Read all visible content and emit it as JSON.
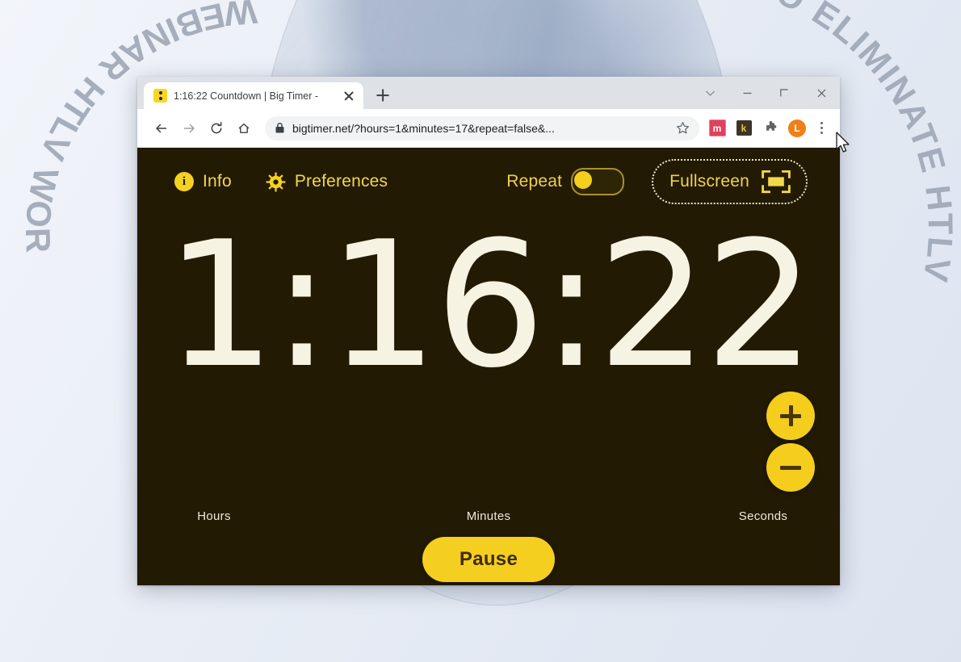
{
  "desktop": {
    "watermark_left": "WEBINAR HTLV WOR",
    "watermark_right": "TO ELIMINATE HTLV",
    "globe_name": "world-globe-graphic"
  },
  "browser": {
    "tab": {
      "title": "1:16:22 Countdown | Big Timer -",
      "favicon_name": "big-timer-favicon",
      "close_label": "×"
    },
    "new_tab_label": "+",
    "window_controls": {
      "tab_search_label": "⌄",
      "minimize_label": "–",
      "maximize_label": "□",
      "close_label": "×"
    },
    "toolbar": {
      "back_label": "←",
      "forward_label": "→",
      "reload_label": "↻",
      "home_label": "⌂",
      "lock_label": "🔒",
      "url": "bigtimer.net/?hours=1&minutes=17&repeat=false&...",
      "star_label": "☆",
      "extensions": [
        {
          "name": "ext-icon-m",
          "label": "m",
          "color": "#e0405e"
        },
        {
          "name": "ext-icon-k",
          "label": "k",
          "color": "#3b3427"
        }
      ],
      "puzzle_label": "extensions",
      "avatar_label": "L",
      "menu_label": "⋮"
    }
  },
  "app": {
    "toolbar": {
      "info_label": "Info",
      "info_icon_glyph": "i",
      "preferences_label": "Preferences",
      "repeat_label": "Repeat",
      "repeat_on": false,
      "fullscreen_label": "Fullscreen"
    },
    "timer": {
      "hours": "1",
      "minutes": "16",
      "seconds": "22",
      "separator": ":",
      "display": "1:16:22"
    },
    "labels": {
      "hours": "Hours",
      "minutes": "Minutes",
      "seconds": "Seconds"
    },
    "stepper": {
      "plus_label": "+",
      "minus_label": "−"
    },
    "pause_label": "Pause",
    "colors": {
      "background": "#231a03",
      "digits": "#f7f3e3",
      "accent": "#f5cf20",
      "label": "#efe9d6"
    }
  }
}
